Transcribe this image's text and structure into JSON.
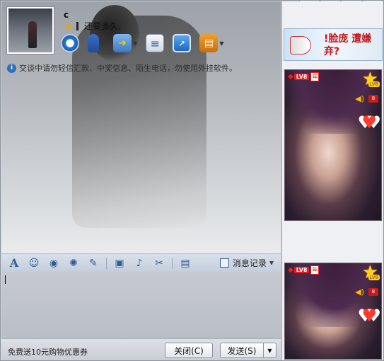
{
  "window": {
    "controls": {
      "menu_glyph": "▣",
      "minimize_glyph": "▁",
      "maximize_glyph": "□",
      "close_glyph": "✕"
    }
  },
  "contact": {
    "name": "c",
    "status_message": "还要多久,"
  },
  "toolbar": {
    "items": [
      {
        "name": "video-chat",
        "icon": "camera-icon"
      },
      {
        "name": "voice-chat",
        "icon": "microphone-icon"
      },
      {
        "name": "send-file",
        "icon": "folder-arrow-icon"
      },
      {
        "name": "apps",
        "icon": "list-add-icon"
      },
      {
        "name": "remote-assist",
        "icon": "monitor-cursor-icon"
      },
      {
        "name": "app-box",
        "icon": "box-icon"
      }
    ]
  },
  "warning_text": "交谈中请勿轻信汇款、中奖信息、陌生电话，勿使用外挂软件。",
  "format_toolbar": {
    "font_glyph": "A",
    "emoji_glyph": "☺",
    "history_label": "消息记录"
  },
  "bottom": {
    "promo_text": "免费送10元购物优惠券",
    "close_label": "关闭(C)",
    "send_label": "发送(S)",
    "dropdown_glyph": "▼"
  },
  "ad": {
    "text": "!脸庞 遭嫌弃?"
  },
  "shows": [
    {
      "level": "LV8",
      "badge": "年",
      "lv_tag": "LV8",
      "mic": "8"
    },
    {
      "level": "LV8",
      "badge": "年",
      "lv_tag": "LV8",
      "mic": "8"
    }
  ],
  "colors": {
    "accent": "#2f5c96",
    "alert_red": "#e21b1b",
    "star_gold": "#ffd21c"
  }
}
